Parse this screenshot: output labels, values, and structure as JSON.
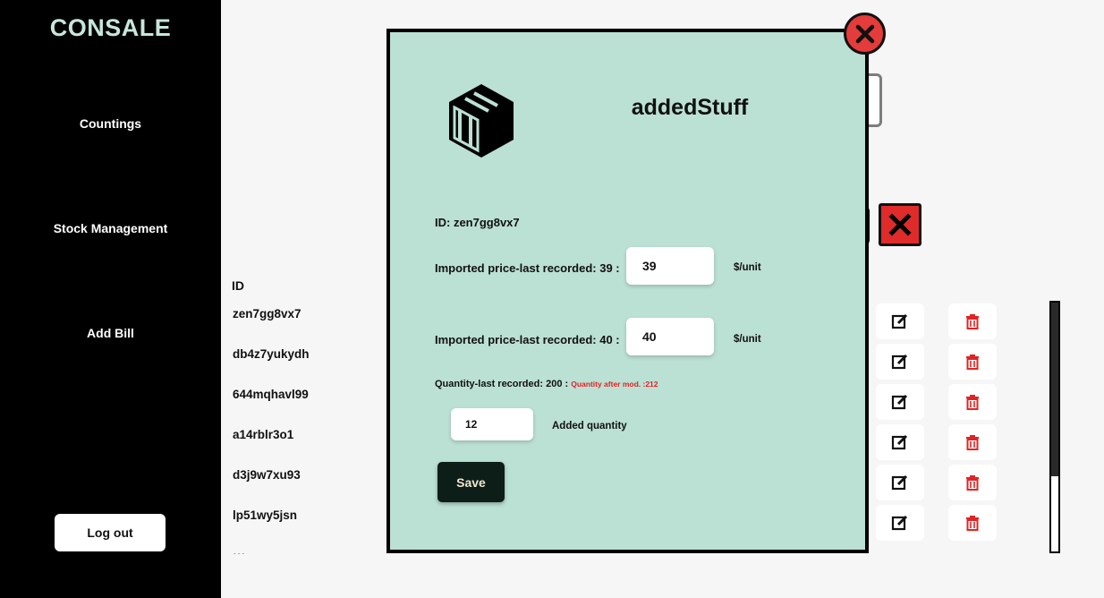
{
  "sidebar": {
    "brand": "CONSALE",
    "items": [
      {
        "label": "Countings"
      },
      {
        "label": "Stock Management"
      },
      {
        "label": "Add Bill"
      }
    ],
    "logout_label": "Log out"
  },
  "list": {
    "id_header": "ID",
    "rows": [
      {
        "id": "zen7gg8vx7"
      },
      {
        "id": "db4z7yukydh"
      },
      {
        "id": "644mqhavl99"
      },
      {
        "id": "a14rblr3o1"
      },
      {
        "id": "d3j9w7xu93"
      },
      {
        "id": "lp51wy5jsn"
      }
    ],
    "scroll_position_fraction": 0.0
  },
  "modal": {
    "title": "addedStuff",
    "id_label": "ID: zen7gg8vx7",
    "price1_label": "Imported price-last recorded: 39 :",
    "price1_value": "39",
    "price2_label": "Imported price-last recorded: 40 :",
    "price2_value": "40",
    "unit_label": "$/unit",
    "quantity_label": "Quantity-last recorded: 200 :",
    "quantity_after_label": "Quantity after mod. :212",
    "added_quantity_value": "12",
    "added_quantity_label": "Added quantity",
    "save_label": "Save"
  },
  "icons": {
    "close": "close-circle-icon",
    "box": "package-box-icon",
    "edit": "edit-icon",
    "delete": "trash-icon"
  },
  "colors": {
    "sidebar_bg": "#000000",
    "brand": "#c7e6dc",
    "modal_bg": "#bbe0d4",
    "danger": "#e02b2b",
    "save_bg": "#0d1e18"
  }
}
